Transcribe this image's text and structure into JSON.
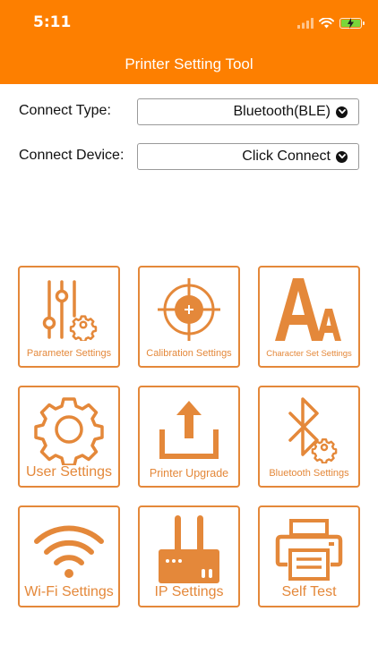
{
  "status_bar": {
    "time": "5:11"
  },
  "header": {
    "title": "Printer Setting Tool"
  },
  "connect_type": {
    "label": "Connect Type:",
    "value": "Bluetooth(BLE)"
  },
  "connect_device": {
    "label": "Connect Device:",
    "value": "Click Connect"
  },
  "tiles": [
    {
      "label": "Parameter Settings",
      "icon": "sliders-gear-icon"
    },
    {
      "label": "Calibration Settings",
      "icon": "crosshair-icon"
    },
    {
      "label": "Character Set Settings",
      "icon": "font-aa-icon"
    },
    {
      "label": "User Settings",
      "icon": "gear-icon"
    },
    {
      "label": "Printer Upgrade",
      "icon": "upload-icon"
    },
    {
      "label": "Bluetooth Settings",
      "icon": "bluetooth-gear-icon"
    },
    {
      "label": "Wi-Fi Settings",
      "icon": "wifi-icon"
    },
    {
      "label": "IP Settings",
      "icon": "router-icon"
    },
    {
      "label": "Self Test",
      "icon": "printer-icon"
    }
  ],
  "colors": {
    "accent": "#fd7f00",
    "tile_orange": "#e4883a",
    "battery": "#7ad63a"
  }
}
